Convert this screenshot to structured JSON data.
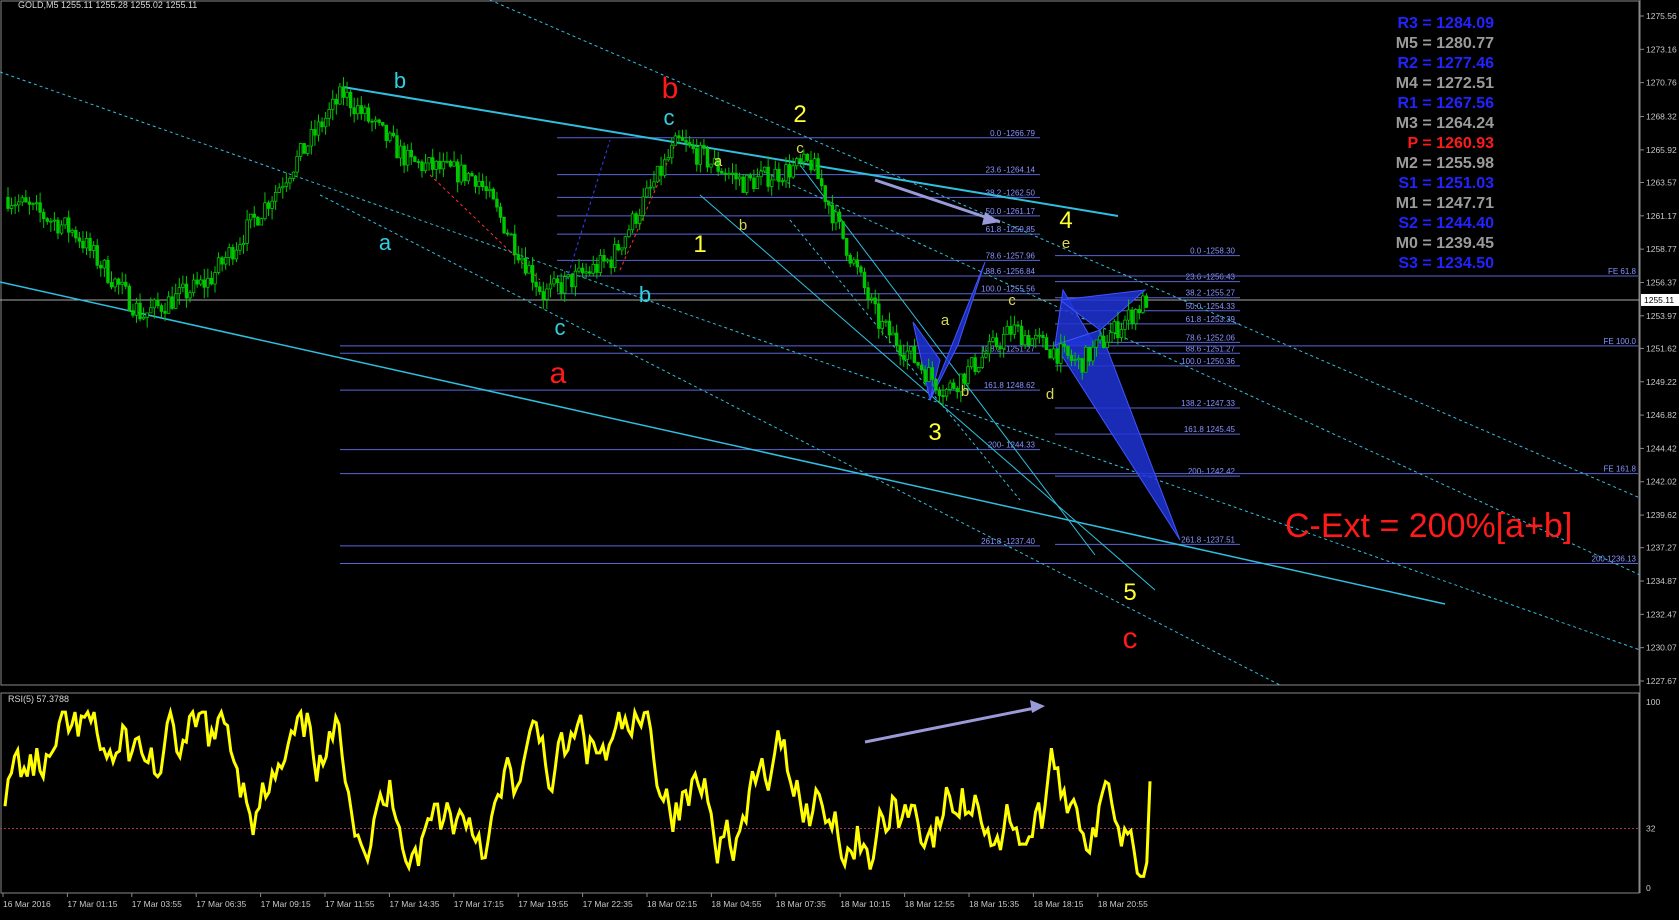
{
  "header": {
    "symbol_line": "GOLD,M5  1255.11 1255.28 1255.02 1255.11",
    "rsi_label": "RSI(5) 57.3788"
  },
  "colors": {
    "background": "#000000",
    "candles": "#00c800",
    "rsi_line": "#ffff00",
    "channel": "#2fbfdf",
    "fib": "#5a64d8",
    "pattern_fill": "#1e33d6",
    "pivot_blue": "#2323ff",
    "pivot_gray": "#9a9a9a",
    "pivot_red": "#ff1a1a"
  },
  "price_axis": {
    "ticks": [
      "1275.56",
      "1273.16",
      "1270.76",
      "1268.32",
      "1265.92",
      "1263.57",
      "1261.17",
      "1258.77",
      "1256.37",
      "1253.97",
      "1251.62",
      "1249.22",
      "1246.82",
      "1244.42",
      "1242.02",
      "1239.62",
      "1237.27",
      "1234.87",
      "1232.47",
      "1230.07",
      "1227.67"
    ],
    "current": "1255.11"
  },
  "rsi_axis": {
    "ticks": [
      "100",
      "32",
      "0"
    ]
  },
  "time_axis": [
    "16 Mar 2016",
    "17 Mar 01:15",
    "17 Mar 03:55",
    "17 Mar 06:35",
    "17 Mar 09:15",
    "17 Mar 11:55",
    "17 Mar 14:35",
    "17 Mar 17:15",
    "17 Mar 19:55",
    "17 Mar 22:35",
    "18 Mar 02:15",
    "18 Mar 04:55",
    "18 Mar 07:35",
    "18 Mar 10:15",
    "18 Mar 12:55",
    "18 Mar 15:35",
    "18 Mar 18:15",
    "18 Mar 20:55"
  ],
  "pivots": [
    {
      "label": "R3 = 1284.09",
      "color": "#2323ff"
    },
    {
      "label": "M5 = 1280.77",
      "color": "#9a9a9a"
    },
    {
      "label": "R2 = 1277.46",
      "color": "#2323ff"
    },
    {
      "label": "M4 = 1272.51",
      "color": "#9a9a9a"
    },
    {
      "label": "R1 = 1267.56",
      "color": "#2323ff"
    },
    {
      "label": "M3 = 1264.24",
      "color": "#9a9a9a"
    },
    {
      "label": "P  = 1260.93",
      "color": "#ff1a1a"
    },
    {
      "label": "M2 = 1255.98",
      "color": "#9a9a9a"
    },
    {
      "label": "S1 = 1251.03",
      "color": "#2323ff"
    },
    {
      "label": "M1 = 1247.71",
      "color": "#9a9a9a"
    },
    {
      "label": "S2 = 1244.40",
      "color": "#2323ff"
    },
    {
      "label": "M0 = 1239.45",
      "color": "#9a9a9a"
    },
    {
      "label": "S3 = 1234.50",
      "color": "#2323ff"
    }
  ],
  "fib_left": [
    "0.0 -1266.79",
    "23.6 -1264.14",
    "38.2 -1262.50",
    "50.0 -1261.17",
    "61.8 -1259.85",
    "78.6 -1257.96",
    "88.6 -1256.84",
    "100.0 -1255.56",
    "138.2 -1251.27",
    "161.8 1248.62",
    "200- 1244.33",
    "261.8 -1237.40"
  ],
  "fib_right": [
    "0.0 -1258.30",
    "23.6 -1256.43",
    "38.2 -1255.27",
    "50.0 -1254.33",
    "61.8 -1253.39",
    "78.6 -1252.06",
    "88.6 -1251.27",
    "100.0 -1250.36",
    "138.2 -1247.33",
    "161.8 1245.45",
    "200- 1242.42",
    "261.8 -1237.51"
  ],
  "fe_labels": [
    "FE 61.8",
    "FE 100.0",
    "FE 161.8",
    "200 1236.13"
  ],
  "wave_labels": {
    "b_cyan_top": "b",
    "a_cyan_left": "a",
    "c_cyan_left": "c",
    "a_red": "a",
    "b_red": "b",
    "c_cyan_top": "c",
    "b_cyan_mid": "b",
    "one": "1",
    "a_small": "a",
    "b_small": "b",
    "two": "2",
    "c_small_2": "c",
    "three": "3",
    "a_small_3": "a",
    "b_small_3": "b",
    "c_small_4": "c",
    "d_small": "d",
    "four": "4",
    "e_small": "e",
    "five": "5",
    "c_red": "c"
  },
  "annotation": "C-Ext = 200%[a+b]",
  "chart_data": {
    "type": "candlestick",
    "title": "GOLD,M5",
    "ohlc_last": {
      "open": 1255.11,
      "high": 1255.28,
      "low": 1255.02,
      "close": 1255.11
    },
    "ylim": [
      1227.67,
      1275.56
    ],
    "approx_close_path": [
      {
        "t": "16 Mar 2016",
        "p": 1262.5
      },
      {
        "t": "17 Mar 01:15",
        "p": 1260.0
      },
      {
        "t": "17 Mar 03:55",
        "p": 1254.0
      },
      {
        "t": "17 Mar 06:35",
        "p": 1256.5
      },
      {
        "t": "17 Mar 09:15",
        "p": 1263.0
      },
      {
        "t": "17 Mar 11:55",
        "p": 1270.0
      },
      {
        "t": "17 Mar 14:35",
        "p": 1265.0
      },
      {
        "t": "17 Mar 17:15",
        "p": 1264.0
      },
      {
        "t": "17 Mar 19:55",
        "p": 1255.5
      },
      {
        "t": "17 Mar 22:35",
        "p": 1258.0
      },
      {
        "t": "18 Mar 02:15",
        "p": 1266.5
      },
      {
        "t": "18 Mar 04:55",
        "p": 1263.5
      },
      {
        "t": "18 Mar 07:35",
        "p": 1265.0
      },
      {
        "t": "18 Mar 10:15",
        "p": 1253.5
      },
      {
        "t": "18 Mar 12:55",
        "p": 1248.5
      },
      {
        "t": "18 Mar 15:35",
        "p": 1253.0
      },
      {
        "t": "18 Mar 18:15",
        "p": 1250.5
      },
      {
        "t": "18 Mar 20:55",
        "p": 1255.1
      }
    ],
    "rsi": {
      "period": 5,
      "last": 57.3788,
      "ylim": [
        0,
        100
      ],
      "level": 32
    }
  }
}
